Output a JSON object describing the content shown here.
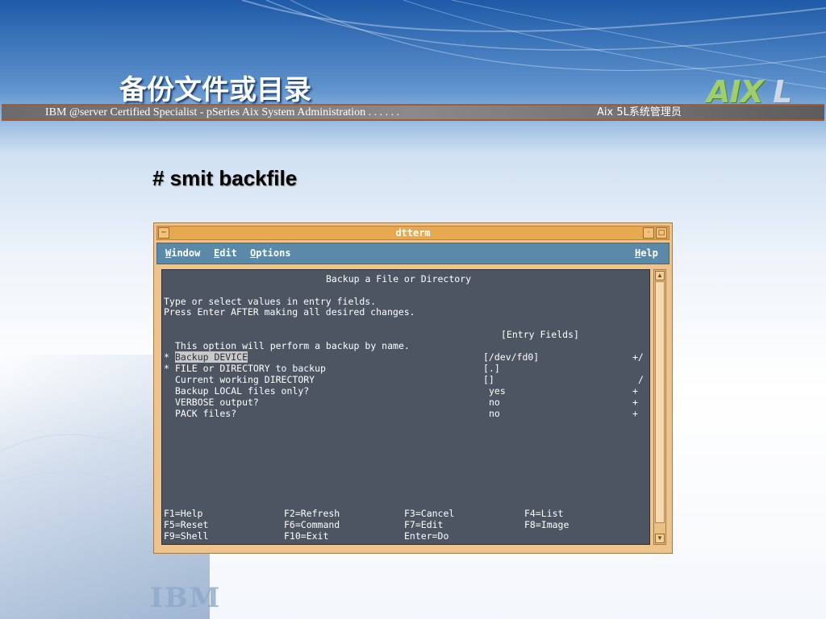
{
  "slide": {
    "title": "备份文件或目录",
    "banner_left": "IBM @server Certified Specialist - pSeries Aix System Administration . . . . . .",
    "banner_right": "Aix 5L系统管理员",
    "logo": "AIX L",
    "command": "# smit backfile",
    "footer_logo": "IBM"
  },
  "window": {
    "title": "dtterm",
    "menu": [
      {
        "label": "Window",
        "mnemonic": "W"
      },
      {
        "label": "Edit",
        "mnemonic": "E"
      },
      {
        "label": "Options",
        "mnemonic": "O"
      },
      {
        "label": "Help",
        "mnemonic": "H"
      }
    ]
  },
  "terminal": {
    "heading": "Backup a File or Directory",
    "instructions": [
      "Type or select values in entry fields.",
      "Press Enter AFTER making all desired changes."
    ],
    "entry_fields_header": "[Entry Fields]",
    "description": "This option will perform a backup by name.",
    "fields": [
      {
        "marker": "*",
        "label": "Backup DEVICE",
        "value": "[/dev/fd0]",
        "flag": "+/"
      },
      {
        "marker": "*",
        "label": "FILE or DIRECTORY to backup",
        "value": "[.]",
        "flag": ""
      },
      {
        "marker": "",
        "label": "Current working DIRECTORY",
        "value": "[]",
        "flag": "/"
      },
      {
        "marker": "",
        "label": "Backup LOCAL files only?",
        "value": "yes",
        "flag": "+"
      },
      {
        "marker": "",
        "label": "VERBOSE output?",
        "value": "no",
        "flag": "+"
      },
      {
        "marker": "",
        "label": "PACK files?",
        "value": "no",
        "flag": "+"
      }
    ],
    "function_keys": [
      [
        "F1=Help",
        "F2=Refresh",
        "F3=Cancel",
        "F4=List"
      ],
      [
        "F5=Reset",
        "F6=Command",
        "F7=Edit",
        "F8=Image"
      ],
      [
        "F9=Shell",
        "F10=Exit",
        "Enter=Do",
        ""
      ]
    ]
  },
  "colors": {
    "terminal_bg": "#4d5562",
    "window_frame": "#eec48c",
    "menubar": "#5a8aa8"
  }
}
